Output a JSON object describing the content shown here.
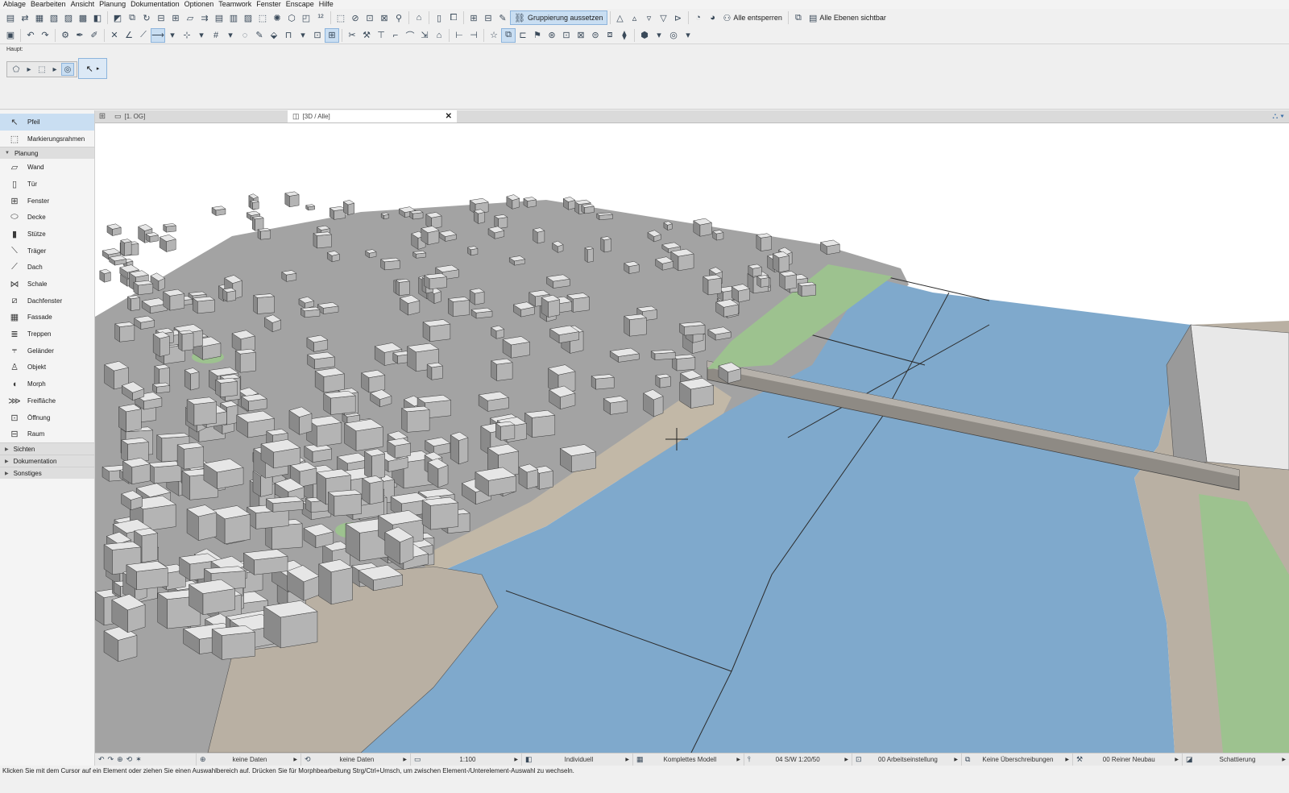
{
  "menu": [
    "Ablage",
    "Bearbeiten",
    "Ansicht",
    "Planung",
    "Dokumentation",
    "Optionen",
    "Teamwork",
    "Fenster",
    "Enscape",
    "Hilfe"
  ],
  "toolbar1": {
    "gruppierung_label": "Gruppierung aussetzen",
    "entsperren_label": "Alle entsperren",
    "ebenen_label": "Alle Ebenen sichtbar"
  },
  "infobox": {
    "label": "Haupt:"
  },
  "toolbox": {
    "top_tools": [
      {
        "label": "Pfeil",
        "icon": "arrow-icon"
      },
      {
        "label": "Markierungsrahmen",
        "icon": "marquee-icon"
      }
    ],
    "planung_label": "Planung",
    "planung_tools": [
      {
        "label": "Wand",
        "icon": "wall-icon"
      },
      {
        "label": "Tür",
        "icon": "door-icon"
      },
      {
        "label": "Fenster",
        "icon": "window-icon"
      },
      {
        "label": "Decke",
        "icon": "slab-icon"
      },
      {
        "label": "Stütze",
        "icon": "column-icon"
      },
      {
        "label": "Träger",
        "icon": "beam-icon"
      },
      {
        "label": "Dach",
        "icon": "roof-icon"
      },
      {
        "label": "Schale",
        "icon": "shell-icon"
      },
      {
        "label": "Dachfenster",
        "icon": "skylight-icon"
      },
      {
        "label": "Fassade",
        "icon": "curtain-wall-icon"
      },
      {
        "label": "Treppen",
        "icon": "stair-icon"
      },
      {
        "label": "Geländer",
        "icon": "railing-icon"
      },
      {
        "label": "Objekt",
        "icon": "object-icon"
      },
      {
        "label": "Morph",
        "icon": "morph-icon"
      },
      {
        "label": "Freifläche",
        "icon": "mesh-icon"
      },
      {
        "label": "Öffnung",
        "icon": "opening-icon"
      },
      {
        "label": "Raum",
        "icon": "zone-icon"
      }
    ],
    "sections": [
      "Sichten",
      "Dokumentation",
      "Sonstiges"
    ]
  },
  "tabs": [
    {
      "label": "[1. OG]",
      "icon": "floorplan-icon"
    },
    {
      "label": "[3D / Alle]",
      "icon": "3d-window-icon"
    }
  ],
  "statusbar": {
    "undo_data": "keine Daten",
    "redo_data": "keine Daten",
    "scale": "1:100",
    "pen_set": "Individuell",
    "model_view": "Komplettes Modell",
    "layer_combo": "04 S/W 1:20/50",
    "dimension": "00 Arbeitseinstellung",
    "overrides": "Keine Überschreibungen",
    "renovation": "00 Reiner Neubau",
    "shading": "Schattierung"
  },
  "hint": "Klicken Sie mit dem Cursor auf ein Element oder ziehen Sie einen Auswahlbereich auf. Drücken Sie für Morphbearbeitung Strg/Ctrl+Umsch, um zwischen Element-/Unterelement-Auswahl zu wechseln.",
  "colors": {
    "water": "#7fa9cc",
    "ground": "#9e9e9e",
    "building_roof": "#e6e6e6",
    "building_wall": "#8a8a8a",
    "green": "#9dc28f",
    "accent": "#c9def2"
  }
}
